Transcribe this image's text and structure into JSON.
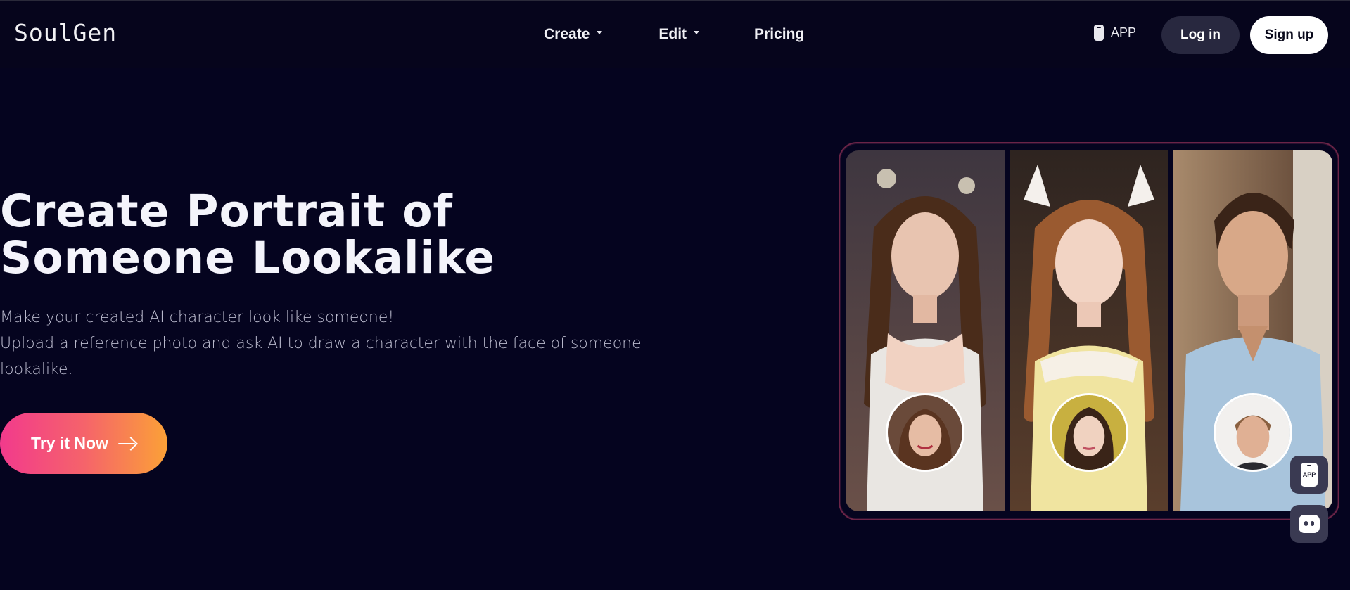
{
  "header": {
    "logo": "SoulGen",
    "nav": [
      {
        "label": "Create",
        "has_dropdown": true
      },
      {
        "label": "Edit",
        "has_dropdown": true
      },
      {
        "label": "Pricing",
        "has_dropdown": false
      }
    ],
    "app_label": "APP",
    "login_label": "Log in",
    "signup_label": "Sign up"
  },
  "hero": {
    "title": "Create Portrait of Someone Lookalike",
    "description_lines": [
      "Make your created AI character look like someone!",
      "Upload a reference photo and ask AI to draw a character with the face of someone lookalike."
    ],
    "cta_label": "Try it Now"
  },
  "showcase": {
    "panels": [
      {
        "name": "panel-brunette-braids",
        "bg": "#5a4a44",
        "hair": "#4a2c1a",
        "skin": "#e8c4b0",
        "dress": "#e9e6e2"
      },
      {
        "name": "panel-auburn-bows",
        "bg": "#3a2a22",
        "hair": "#9a5a30",
        "skin": "#f2d4c4",
        "dress": "#f0e4a0"
      },
      {
        "name": "panel-man-blue-shirt",
        "bg": "#8a6a50",
        "hair": "#3a2418",
        "skin": "#d8a888",
        "dress": "#a8c4dc"
      }
    ]
  },
  "floating": {
    "app_badge": "APP"
  },
  "colors": {
    "background": "#05041f",
    "header_bg": "#06051c",
    "login_bg": "#28283f",
    "signup_bg": "#ffffff",
    "cta_gradient_start": "#f23a8c",
    "cta_gradient_end": "#fba137",
    "frame_border": "#6b2447"
  }
}
